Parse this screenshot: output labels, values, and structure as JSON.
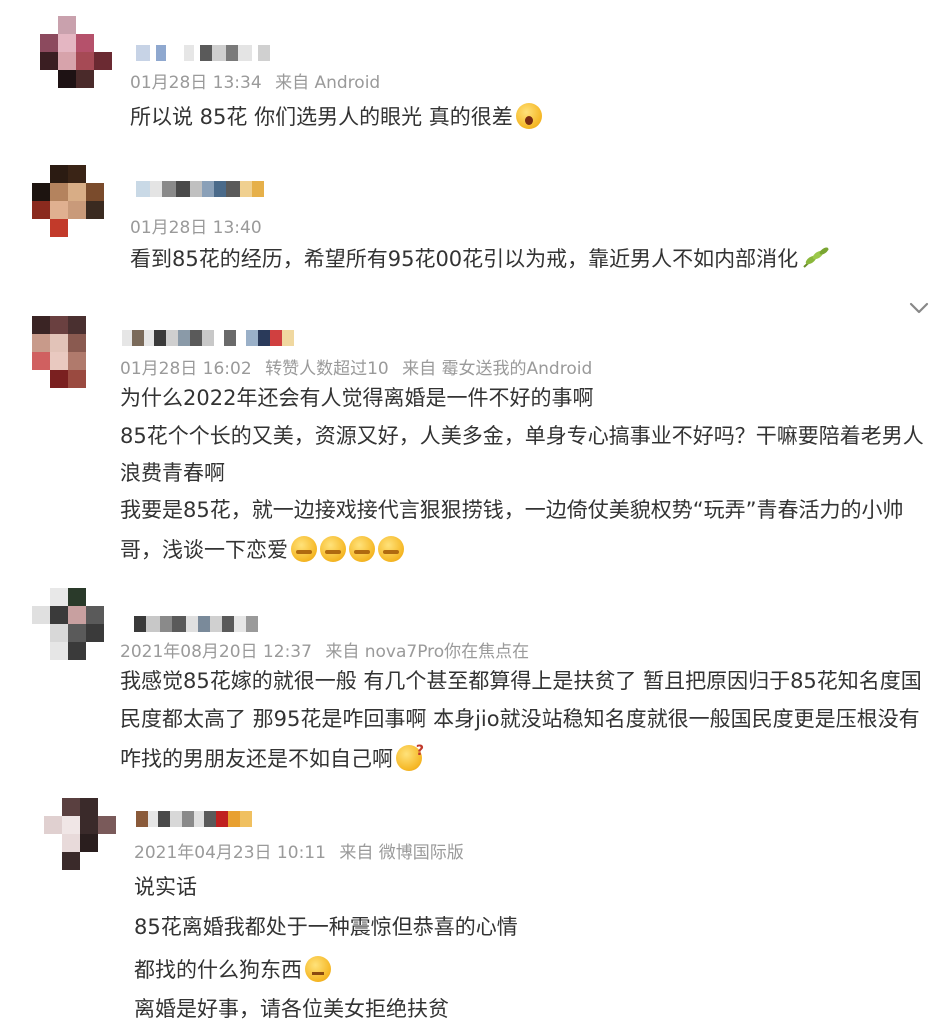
{
  "comments": [
    {
      "meta": {
        "time": "01月28日 13:34",
        "source": "来自 Android"
      },
      "lines": [
        "所以说 85花 你们选男人的眼光 真的很差"
      ]
    },
    {
      "meta": {
        "time": "01月28日 13:40"
      },
      "lines": [
        "看到85花的经历，希望所有95花00花引以为戒，靠近男人不如内部消化"
      ]
    },
    {
      "meta": {
        "time": "01月28日 16:02",
        "extra": "转赞人数超过10",
        "source": "来自 霉女送我的Android"
      },
      "lines": [
        "为什么2022年还会有人觉得离婚是一件不好的事啊",
        "85花个个长的又美，资源又好，人美多金，单身专心搞事业不好吗？干嘛要陪着老男人",
        "浪费青春啊",
        "我要是85花，就一边接戏接代言狠狠捞钱，一边倚仗美貌权势“玩弄”青春活力的小帅",
        "哥，浅谈一下恋爱"
      ]
    },
    {
      "meta": {
        "time": "2021年08月20日 12:37",
        "source": "来自 nova7Pro你在焦点在"
      },
      "lines": [
        "我感觉85花嫁的就很一般 有几个甚至都算得上是扶贫了 暂且把原因归于85花知名度国",
        "民度都太高了 那95花是咋回事啊 本身jio就没站稳知名度就很一般国民度更是压根没有",
        "咋找的男朋友还是不如自己啊"
      ]
    },
    {
      "meta": {
        "time": "2021年04月23日 10:11",
        "source": "来自 微博国际版"
      },
      "lines": [
        "说实话",
        "85花离婚我都处于一种震惊但恭喜的心情",
        "都找的什么狗东西",
        "离婚是好事，请各位美女拒绝扶贫"
      ]
    }
  ],
  "icons": {
    "comment1_emoji": "shocked-face-icon",
    "comment2_emoji": "leaf-icon",
    "comment3_emoji": "thinking-face-icon",
    "comment4_emoji": "question-face-icon",
    "comment5_emoji": "meh-face-icon",
    "expand": "chevron-down-icon"
  }
}
